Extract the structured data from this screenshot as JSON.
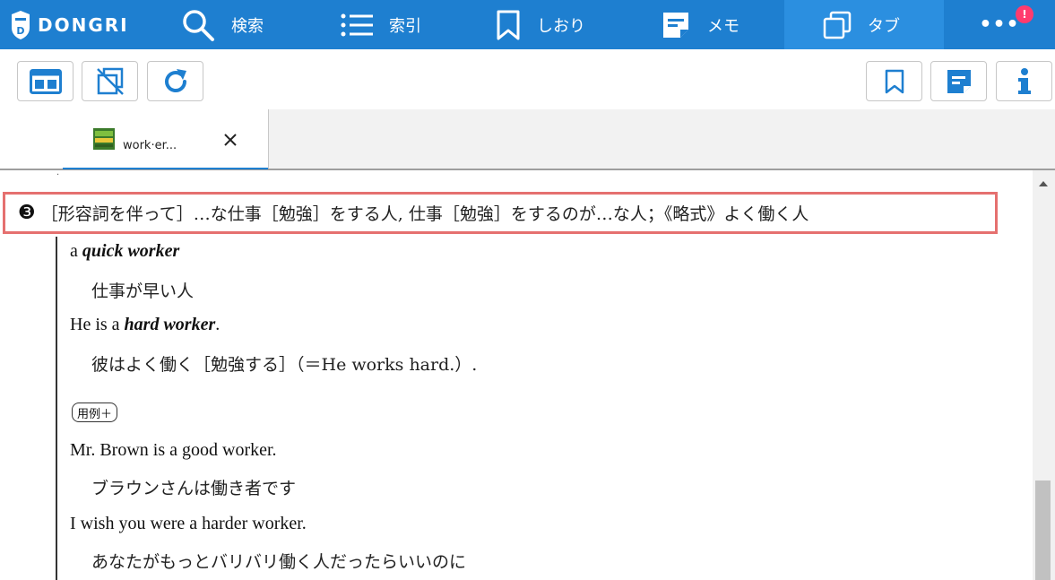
{
  "app": {
    "brand": "DONGRI"
  },
  "nav": {
    "search": "検索",
    "index": "索引",
    "bookmarks": "しおり",
    "memo": "メモ",
    "tabs": "タブ",
    "more": "•••",
    "notification_badge": "!"
  },
  "tab": {
    "title": "work·er..."
  },
  "entry": {
    "sense_number": "❸",
    "sense_text": "［形容詞を伴って］…な仕事［勉強］をする人, 仕事［勉強］をするのが…な人；《略式》よく働く人",
    "examples": [
      {
        "prefix": "a ",
        "bold": "quick worker",
        "suffix": "",
        "translation": "仕事が早い人"
      },
      {
        "prefix": "He is a ",
        "bold": "hard worker",
        "suffix": ".",
        "translation": "彼はよく働く［勉強する］（＝He works hard.）."
      }
    ],
    "more_examples_label": "用例＋",
    "more_examples": [
      {
        "text": "Mr. Brown is a good worker.",
        "translation": "ブラウンさんは働き者です"
      },
      {
        "text": "I wish you were a harder worker.",
        "translation": "あなたがもっとバリバリ働く人だったらいいのに"
      }
    ]
  },
  "colors": {
    "nav_bg": "#1e7fd0",
    "nav_active_bg": "#2b8fe0",
    "accent": "#1e7fd0",
    "highlight_border": "#e5706f",
    "badge": "#ff3b6e"
  },
  "icons": {
    "logo": "dongri-shield-logo",
    "search": "search-icon",
    "index": "list-icon",
    "bookmarks": "bookmark-icon",
    "memo": "memo-icon",
    "tabs": "tabs-icon",
    "more": "more-icon",
    "layout": "layout-icon",
    "no_sync": "no-sync-icon",
    "refresh": "refresh-icon",
    "bookmark_add": "bookmark-icon",
    "memo_add": "memo-icon",
    "info": "info-icon",
    "close": "close-icon"
  }
}
